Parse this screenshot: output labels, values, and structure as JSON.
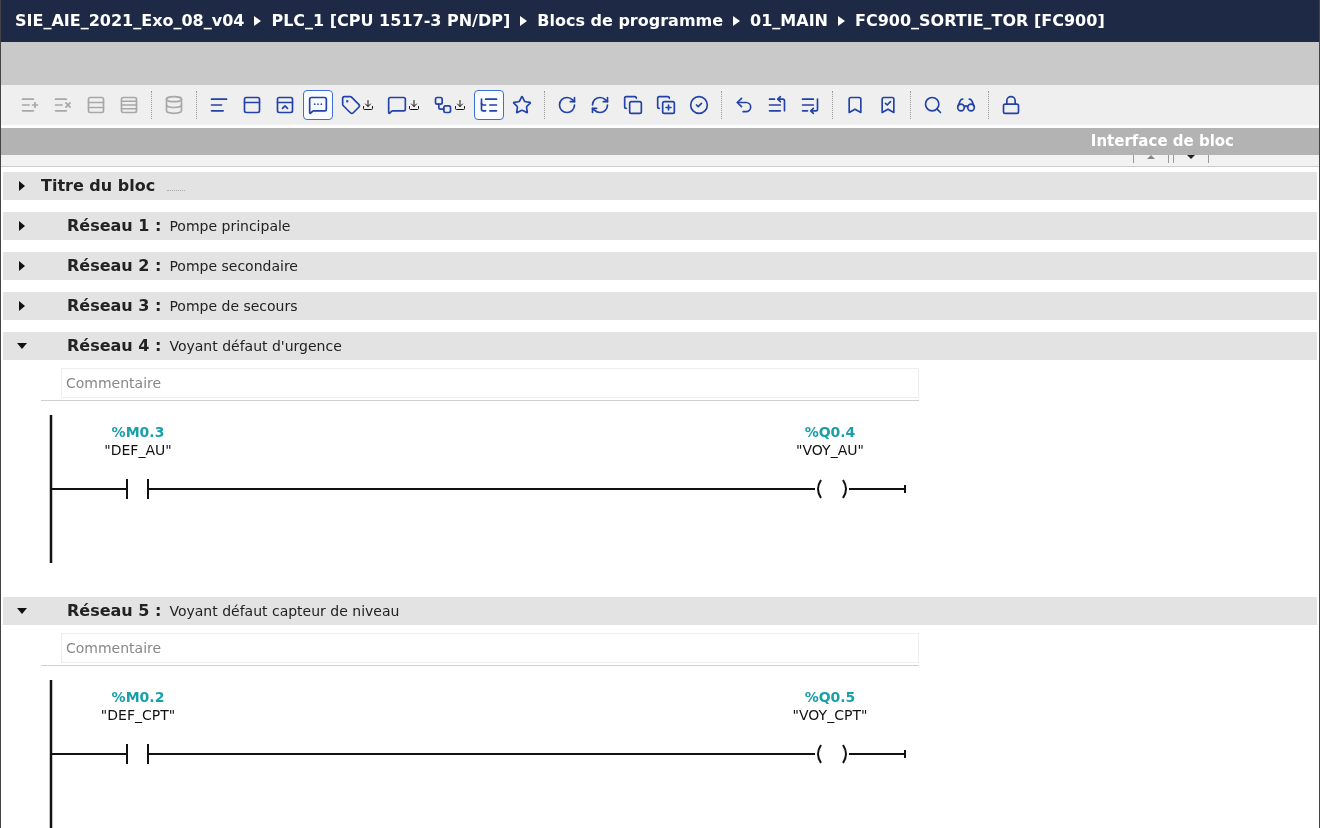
{
  "window": {
    "breadcrumb": [
      {
        "text": "SIE_AIE_2021_Exo_08_v04"
      },
      {
        "text": "PLC_1 [CPU 1517-3 PN/DP]"
      },
      {
        "text": "Blocs de programme"
      },
      {
        "text": "01_MAIN"
      },
      {
        "text": "FC900_SORTIE_TOR [FC900]"
      }
    ]
  },
  "toolbar": [
    {
      "kind": "insert",
      "on": false,
      "disabled": true
    },
    {
      "kind": "remove",
      "on": false,
      "disabled": true
    },
    {
      "kind": "rowinsert",
      "on": false,
      "disabled": true
    },
    {
      "kind": "rowappend",
      "on": false,
      "disabled": true
    },
    {
      "kind": "separator"
    },
    {
      "kind": "database",
      "on": false,
      "disabled": true
    },
    {
      "kind": "separator"
    },
    {
      "kind": "lines",
      "on": false,
      "disabled": false
    },
    {
      "kind": "panel",
      "on": false,
      "disabled": false
    },
    {
      "kind": "panelsolid",
      "on": false,
      "disabled": false
    },
    {
      "kind": "comment",
      "on": true,
      "disabled": false
    },
    {
      "kind": "tagdown",
      "on": false,
      "disabled": false
    },
    {
      "kind": "bubbledown",
      "on": false,
      "disabled": false
    },
    {
      "kind": "netdown",
      "on": false,
      "disabled": false
    },
    {
      "kind": "list",
      "on": true,
      "disabled": false
    },
    {
      "kind": "favorites",
      "on": false,
      "disabled": false
    },
    {
      "kind": "separator"
    },
    {
      "kind": "reset",
      "on": false,
      "disabled": false
    },
    {
      "kind": "resetall",
      "on": false,
      "disabled": false
    },
    {
      "kind": "copy",
      "on": false,
      "disabled": false
    },
    {
      "kind": "copyall",
      "on": false,
      "disabled": false
    },
    {
      "kind": "compile",
      "on": false,
      "disabled": false
    },
    {
      "kind": "separator"
    },
    {
      "kind": "jump",
      "on": false,
      "disabled": false
    },
    {
      "kind": "linestart",
      "on": false,
      "disabled": false
    },
    {
      "kind": "lineend",
      "on": false,
      "disabled": false
    },
    {
      "kind": "separator"
    },
    {
      "kind": "bookmarkprev",
      "on": false,
      "disabled": false
    },
    {
      "kind": "bookmarknext",
      "on": false,
      "disabled": false
    },
    {
      "kind": "separator"
    },
    {
      "kind": "inspect",
      "on": false,
      "disabled": false
    },
    {
      "kind": "monitor",
      "on": false,
      "disabled": false
    },
    {
      "kind": "separator"
    },
    {
      "kind": "dblock",
      "on": false,
      "disabled": false
    }
  ],
  "interface_bar": {
    "title": "Interface de bloc"
  },
  "block_title": {
    "label": "Titre du bloc",
    "expanded": false
  },
  "networks": [
    {
      "label": "Réseau 1 :",
      "title": "Pompe principale",
      "expanded": false
    },
    {
      "label": "Réseau 2 :",
      "title": "Pompe secondaire",
      "expanded": false
    },
    {
      "label": "Réseau 3 :",
      "title": "Pompe de secours",
      "expanded": false
    },
    {
      "label": "Réseau 4 :",
      "title": "Voyant défaut d'urgence",
      "expanded": true,
      "comment_placeholder": "Commentaire",
      "contact": {
        "address": "%M0.3",
        "symbol": "\"DEF_AU\""
      },
      "coil": {
        "address": "%Q0.4",
        "symbol": "\"VOY_AU\""
      }
    },
    {
      "label": "Réseau 5 :",
      "title": "Voyant défaut capteur de niveau",
      "expanded": true,
      "comment_placeholder": "Commentaire",
      "contact": {
        "address": "%M0.2",
        "symbol": "\"DEF_CPT\""
      },
      "coil": {
        "address": "%Q0.5",
        "symbol": "\"VOY_CPT\""
      }
    }
  ]
}
